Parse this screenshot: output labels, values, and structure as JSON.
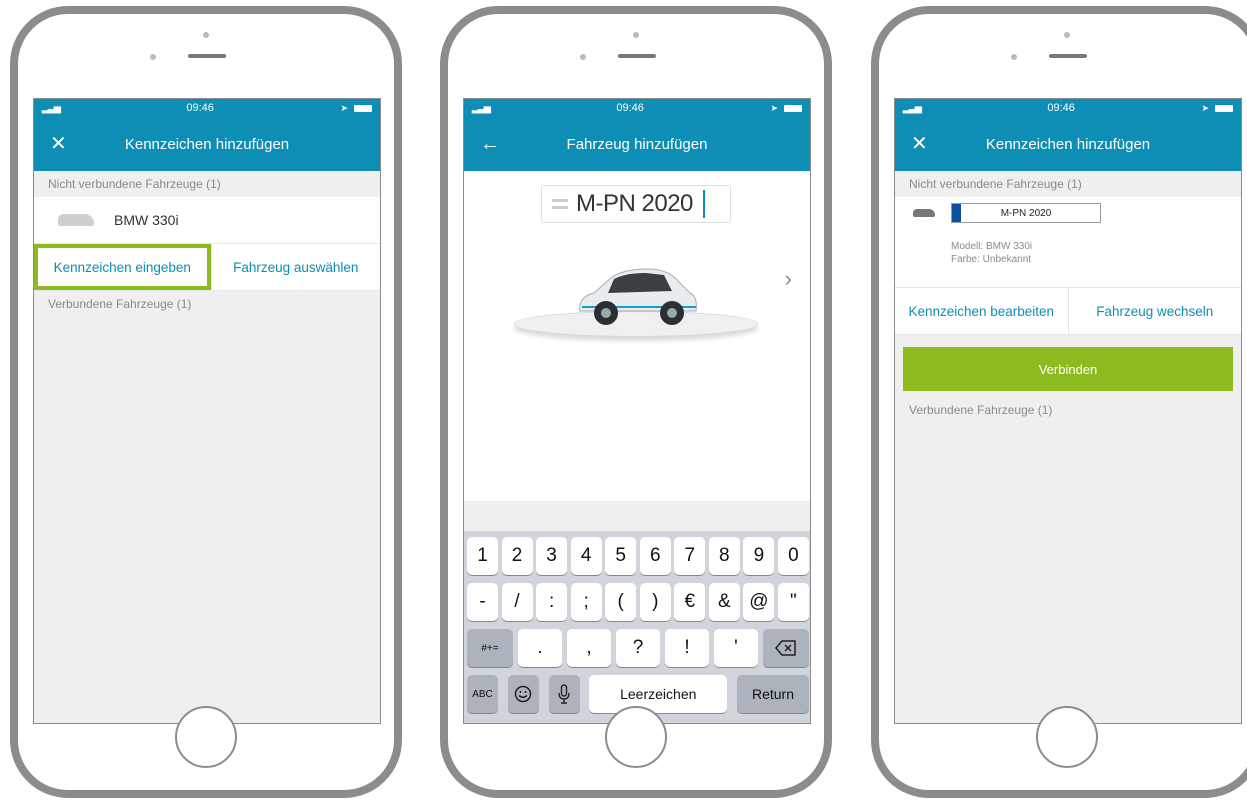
{
  "status": {
    "time": "09:46"
  },
  "screen1": {
    "title": "Kennzeichen hinzufügen",
    "section_unconnected": "Nicht verbundene Fahrzeuge (1)",
    "vehicle": "BMW 330i",
    "action_plate": "Kennzeichen eingeben",
    "action_select": "Fahrzeug auswählen",
    "section_connected": "Verbundene Fahrzeuge (1)"
  },
  "screen2": {
    "title": "Fahrzeug hinzufügen",
    "plate_value": "M-PN 2020",
    "keyboard": {
      "row1": [
        "1",
        "2",
        "3",
        "4",
        "5",
        "6",
        "7",
        "8",
        "9",
        "0"
      ],
      "row2": [
        "-",
        "/",
        ":",
        ";",
        "(",
        ")",
        "€",
        "&",
        "@",
        "\""
      ],
      "row3_mode": "#+=",
      "row3": [
        ".",
        ",",
        "?",
        "!",
        "'"
      ],
      "row4_abc": "ABC",
      "space": "Leerzeichen",
      "return": "Return"
    }
  },
  "screen3": {
    "title": "Kennzeichen hinzufügen",
    "section_unconnected": "Nicht verbundene Fahrzeuge (1)",
    "plate_value": "M-PN 2020",
    "model": "Modell: BMW 330i",
    "color": "Farbe: Unbekannt",
    "action_edit": "Kennzeichen bearbeiten",
    "action_change": "Fahrzeug wechseln",
    "connect": "Verbinden",
    "section_connected": "Verbundene Fahrzeuge (1)"
  },
  "colors": {
    "header": "#0e8db5",
    "accent_green": "#8cba1f",
    "link": "#0e8db5"
  }
}
